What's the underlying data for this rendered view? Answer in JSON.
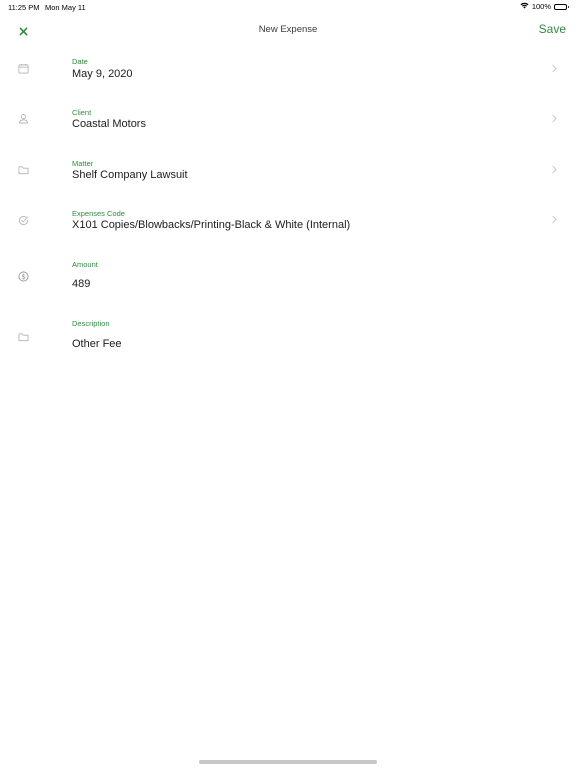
{
  "status_bar": {
    "time": "11:25 PM",
    "date": "Mon May 11",
    "battery": "100%",
    "wifi_icon": "wifi-icon",
    "battery_icon": "battery-icon"
  },
  "nav": {
    "close_icon": "close-icon",
    "title": "New Expense",
    "save_label": "Save"
  },
  "colors": {
    "accent": "#2e8b3e",
    "icon_gray": "#b0b0b5",
    "chevron_gray": "#c7c7cc"
  },
  "fields": {
    "date": {
      "label": "Date",
      "value": "May 9, 2020",
      "icon": "calendar-icon"
    },
    "client": {
      "label": "Client",
      "value": "Coastal Motors",
      "icon": "person-icon"
    },
    "matter": {
      "label": "Matter",
      "value": "Shelf Company Lawsuit",
      "icon": "folder-icon"
    },
    "expenses_code": {
      "label": "Expenses Code",
      "value": "X101 Copies/Blowbacks/Printing-Black & White (Internal)",
      "icon": "checkmark-circle-icon"
    },
    "amount": {
      "label": "Amount",
      "value": "489",
      "icon": "dollar-circle-icon"
    },
    "description": {
      "label": "Description",
      "value": "Other Fee",
      "icon": "folder-icon"
    }
  }
}
